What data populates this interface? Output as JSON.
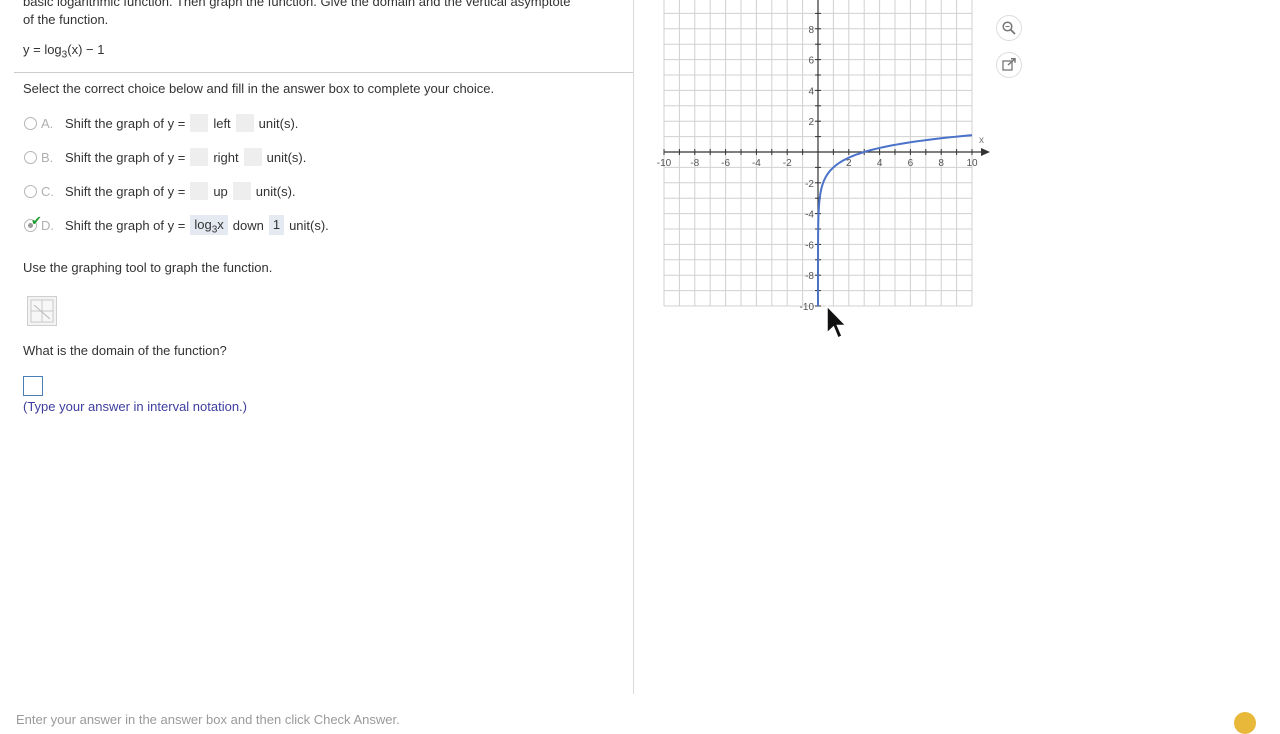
{
  "question": {
    "intro_line1": "basic logarithmic function. Then graph the function. Give the domain and the vertical asymptote",
    "intro_line2": "of the function.",
    "equation_prefix": "y = log",
    "equation_base": "3",
    "equation_suffix": "(x) − 1",
    "instruction": "Select the correct choice below and fill in the answer box to complete your choice."
  },
  "choices": [
    {
      "letter": "A.",
      "text": "Shift the graph of y =",
      "direction": "left",
      "unit": "unit(s).",
      "selected": false
    },
    {
      "letter": "B.",
      "text": "Shift the graph of y =",
      "direction": "right",
      "unit": "unit(s).",
      "selected": false
    },
    {
      "letter": "C.",
      "text": "Shift the graph of y =",
      "direction": "up",
      "unit": "unit(s).",
      "selected": false
    },
    {
      "letter": "D.",
      "text": "Shift the graph of y =",
      "answer_func": "log",
      "answer_base": "3",
      "answer_var": "x",
      "direction": "down",
      "answer_amount": "1",
      "unit": "unit(s).",
      "selected": true
    }
  ],
  "graph_prompt": "Use the graphing tool to graph the function.",
  "domain_prompt": "What is the domain of the function?",
  "domain_hint": "(Type your answer in interval notation.)",
  "footer": "Enter your answer in the answer box and then click Check Answer.",
  "colors": {
    "curve": "#4a72c9",
    "grid": "#d0d0d0",
    "check": "#1a9c2e"
  },
  "chart_data": {
    "type": "line",
    "function": "y = log_3(x) - 1",
    "xlim": [
      -10,
      10
    ],
    "ylim": [
      -10,
      10
    ],
    "x_ticks": [
      "-10",
      "-8",
      "-6",
      "-4",
      "-2",
      "2",
      "4",
      "6",
      "8",
      "10"
    ],
    "y_ticks": [
      "8",
      "6",
      "4",
      "2",
      "-2",
      "-4",
      "-6",
      "-8",
      "-10"
    ],
    "xlabel": "x",
    "grid": true
  }
}
